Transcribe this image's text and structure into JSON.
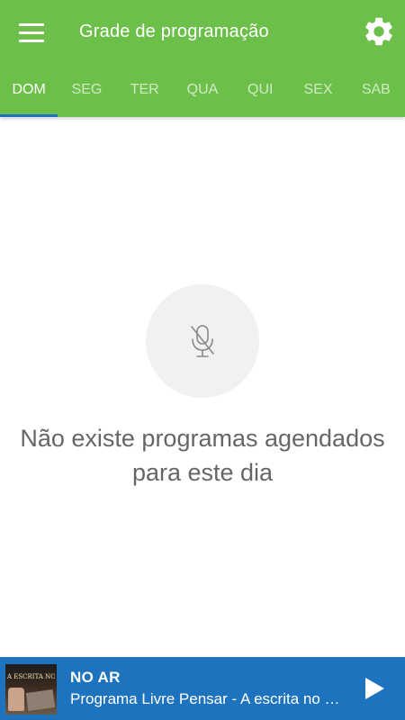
{
  "header": {
    "title": "Grade de programação",
    "menu_icon": "hamburger-menu-icon",
    "settings_icon": "gear-icon",
    "color": "#6cc04a"
  },
  "tabs": [
    {
      "label": "DOM",
      "active": true
    },
    {
      "label": "SEG",
      "active": false
    },
    {
      "label": "TER",
      "active": false
    },
    {
      "label": "QUA",
      "active": false
    },
    {
      "label": "QUI",
      "active": false
    },
    {
      "label": "SEX",
      "active": false
    },
    {
      "label": "SAB",
      "active": false
    }
  ],
  "tab_indicator_color": "#1a73c6",
  "empty_state": {
    "icon": "microphone-off-icon",
    "message": "Não existe programas agendados para este dia"
  },
  "player": {
    "status_label": "NO AR",
    "program_title": "Programa Livre Pensar - A escrita no Exílio",
    "thumbnail_text": "A ESCRITA NO EXÍLIO",
    "play_icon": "play-icon",
    "color": "#1e73be"
  }
}
